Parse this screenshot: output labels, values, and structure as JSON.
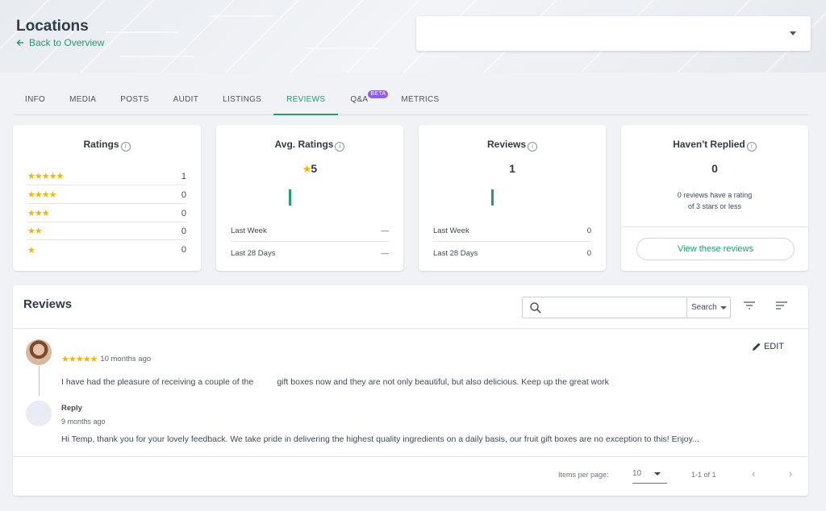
{
  "header": {
    "title": "Locations",
    "back_label": "Back to Overview",
    "location_select_value": ""
  },
  "tabs": [
    {
      "label": "INFO"
    },
    {
      "label": "MEDIA"
    },
    {
      "label": "POSTS"
    },
    {
      "label": "AUDIT"
    },
    {
      "label": "LISTINGS"
    },
    {
      "label": "REVIEWS",
      "active": true
    },
    {
      "label": "Q&A",
      "badge": "BETA"
    },
    {
      "label": "METRICS"
    }
  ],
  "ratings_card": {
    "title": "Ratings",
    "rows": [
      {
        "stars": "★★★★★",
        "count": "1"
      },
      {
        "stars": "★★★★",
        "count": "0"
      },
      {
        "stars": "★★★",
        "count": "0"
      },
      {
        "stars": "★★",
        "count": "0"
      },
      {
        "stars": "★",
        "count": "0"
      }
    ]
  },
  "avg_card": {
    "title": "Avg. Ratings",
    "star": "★",
    "value": "5",
    "last_week_label": "Last Week",
    "last_week_value": "—",
    "last_28_label": "Last 28 Days",
    "last_28_value": "—"
  },
  "reviews_card": {
    "title": "Reviews",
    "value": "1",
    "last_week_label": "Last Week",
    "last_week_value": "0",
    "last_28_label": "Last 28 Days",
    "last_28_value": "0"
  },
  "not_replied_card": {
    "title": "Haven't Replied",
    "value": "0",
    "note_line1": "0 reviews have a rating",
    "note_line2": "of 3 stars or less",
    "button_label": "View these reviews"
  },
  "reviews_panel": {
    "heading": "Reviews",
    "search_placeholder": "",
    "search_type": "Search",
    "review": {
      "stars": "★★★★★",
      "time": "10 months ago",
      "text": "I have had the pleasure of receiving a couple of the          gift boxes now and they are not only beautiful, but also delicious. Keep up the great work",
      "edit_label": "EDIT"
    },
    "reply": {
      "label": "Reply",
      "time": "9 months ago",
      "text": "Hi Temp, thank you for your lovely feedback. We take pride in delivering the highest quality ingredients on a daily basis, our fruit gift boxes are no exception to this! Enjoy..."
    },
    "pager": {
      "items_per_page_label": "Items per page:",
      "items_per_page_value": "10",
      "range": "1-1 of 1"
    }
  },
  "colors": {
    "accent": "#1f9e6e",
    "star": "#f5b400",
    "beta_badge": "#8e5fe0"
  }
}
